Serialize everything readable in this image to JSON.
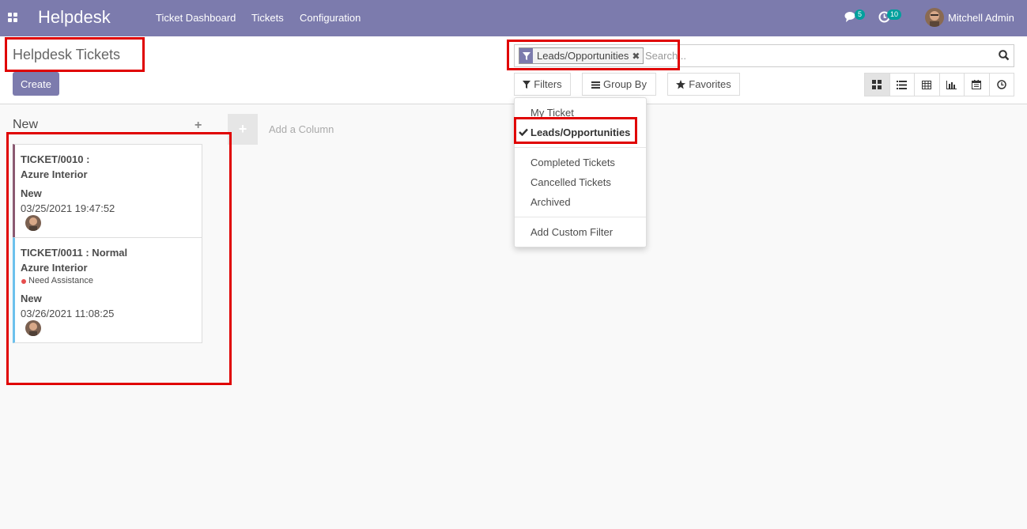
{
  "navbar": {
    "brand": "Helpdesk",
    "menu": [
      "Ticket Dashboard",
      "Tickets",
      "Configuration"
    ],
    "messages_count": "5",
    "activities_count": "10",
    "user_name": "Mitchell Admin"
  },
  "control_panel": {
    "title": "Helpdesk Tickets",
    "create_label": "Create",
    "search": {
      "facet_label": "Leads/Opportunities",
      "placeholder": "Search..."
    },
    "filters_label": "Filters",
    "group_by_label": "Group By",
    "favorites_label": "Favorites",
    "views": [
      "kanban",
      "list",
      "pivot",
      "graph",
      "calendar",
      "activity"
    ],
    "active_view": "kanban"
  },
  "filters_dropdown": {
    "items": [
      "My Ticket",
      "Leads/Opportunities",
      "Completed Tickets",
      "Cancelled Tickets",
      "Archived",
      "Add Custom Filter"
    ],
    "selected": "Leads/Opportunities"
  },
  "kanban": {
    "column_title": "New",
    "add_column_label": "Add a Column",
    "cards": [
      {
        "ref": "TICKET/0010 :",
        "customer": "Azure Interior",
        "tag": "",
        "stage": "New",
        "date": "03/25/2021 19:47:52",
        "accent": "#8b5a72"
      },
      {
        "ref": "TICKET/0011 : Normal",
        "customer": "Azure Interior",
        "tag": "Need Assistance",
        "stage": "New",
        "date": "03/26/2021 11:08:25",
        "accent": "#6cc1ed"
      }
    ]
  },
  "colors": {
    "brand": "#7c7bad",
    "badge": "#00a09d",
    "highlight": "#e00000"
  }
}
